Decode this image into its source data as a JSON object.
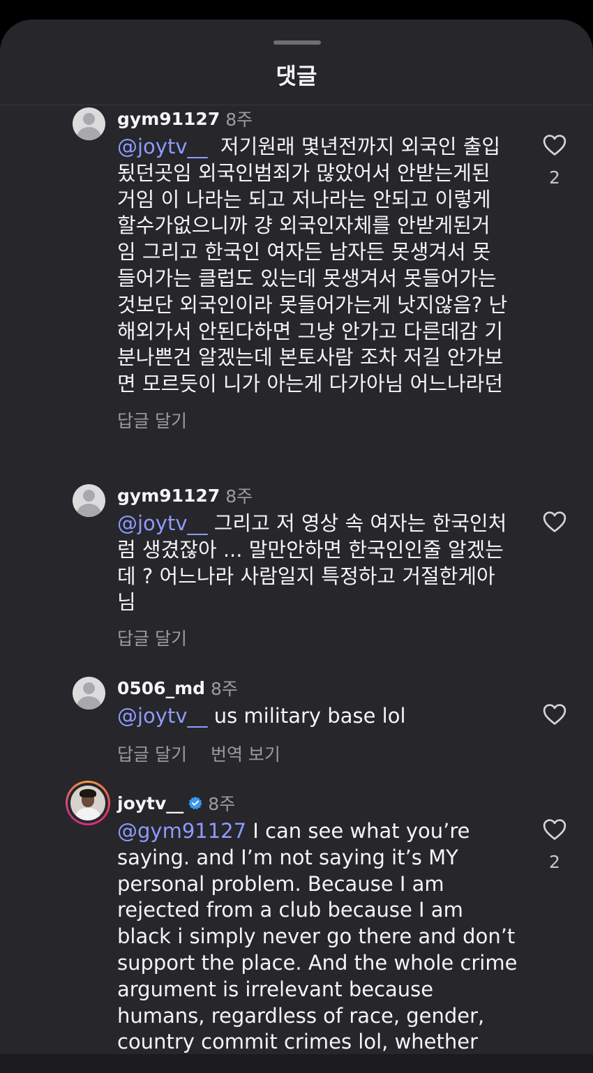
{
  "sheet": {
    "title": "댓글"
  },
  "comments": [
    {
      "username": "gym91127",
      "time": "8주",
      "mention": "@joytv__",
      "lines": [
        "  저기원래 몇년전까지 외국인 출입",
        "됬던곳임 외국인범죄가 많았어서 안받는게된",
        "거임 이 나라는 되고 저나라는 안되고 이렇게",
        "할수가없으니까 걍 외국인자체를 안받게된거",
        "임 그리고 한국인 여자든 남자든 못생겨서 못",
        "들어가는 클럽도 있는데 못생겨서 못들어가는",
        "것보단 외국인이라 못들어가는게 낫지않음? 난",
        "해외가서 안된다하면 그냥 안가고 다른데감 기",
        "분나쁜건 알겠는데 본토사람 조차 저길 안가보",
        "면 모르듯이 니가 아는게 다가아님 어느나라던"
      ],
      "reply_label": "답글 달기",
      "likes": "2"
    },
    {
      "username": "gym91127",
      "time": "8주",
      "mention": "@joytv__",
      "lines": [
        " 그리고 저 영상 속 여자는 한국인처",
        "럼 생겼잖아 ... 말만안하면 한국인인줄 알겠는",
        "데 ? 어느나라 사람일지 특정하고 거절한게아",
        "님"
      ],
      "reply_label": "답글 달기"
    },
    {
      "username": "0506_md",
      "time": "8주",
      "mention": "@joytv__",
      "lines": [
        " us military base lol"
      ],
      "reply_label": "답글 달기",
      "translate_label": "번역 보기"
    },
    {
      "username": "joytv__",
      "time": "8주",
      "verified": true,
      "mention": "@gym91127",
      "lines": [
        " I can see what you’re",
        "saying. and I’m not saying it’s MY",
        "personal problem. Because I am",
        "rejected from a club because I am",
        "black i simply never go there and don’t",
        "support the place. And the whole crime",
        "argument is irrelevant because",
        "humans, regardless of race, gender,",
        "country commit crimes lol, whether"
      ],
      "likes": "2"
    }
  ],
  "colors": {
    "background": "#26262b",
    "mention": "#8e9bfb",
    "muted": "#9b9ba0",
    "verified": "#3897f0"
  },
  "icons": {
    "like": "heart-outline-icon",
    "verified": "verified-badge-icon",
    "avatar": "default-avatar-icon"
  }
}
